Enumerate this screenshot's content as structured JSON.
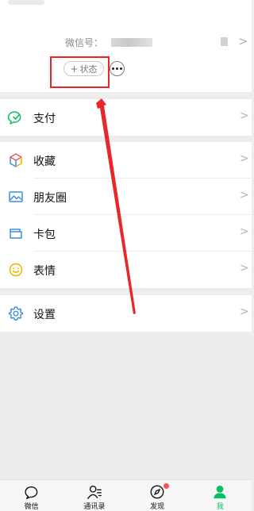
{
  "profile": {
    "wechat_id_label": "微信号：",
    "status_button": {
      "plus": "+",
      "label": "状态"
    }
  },
  "menu": {
    "pay": {
      "label": "支付",
      "icon": "pay-icon"
    },
    "favorites": {
      "label": "收藏",
      "icon": "favorites-cube-icon"
    },
    "moments": {
      "label": "朋友圈",
      "icon": "moments-image-icon"
    },
    "cards": {
      "label": "卡包",
      "icon": "card-wallet-icon"
    },
    "stickers": {
      "label": "表情",
      "icon": "smiley-icon"
    },
    "settings": {
      "label": "设置",
      "icon": "gear-icon"
    },
    "chevron": ">"
  },
  "tabbar": {
    "tabs": [
      {
        "label": "微信",
        "icon": "chat-bubble-icon",
        "active": false
      },
      {
        "label": "通讯录",
        "icon": "contacts-icon",
        "active": false
      },
      {
        "label": "发现",
        "icon": "compass-icon",
        "active": false,
        "badge": true
      },
      {
        "label": "我",
        "icon": "person-icon",
        "active": true
      }
    ]
  },
  "colors": {
    "accent": "#07c160",
    "annotation": "#e8272a",
    "badge": "#fa5151",
    "background": "#ededed"
  }
}
